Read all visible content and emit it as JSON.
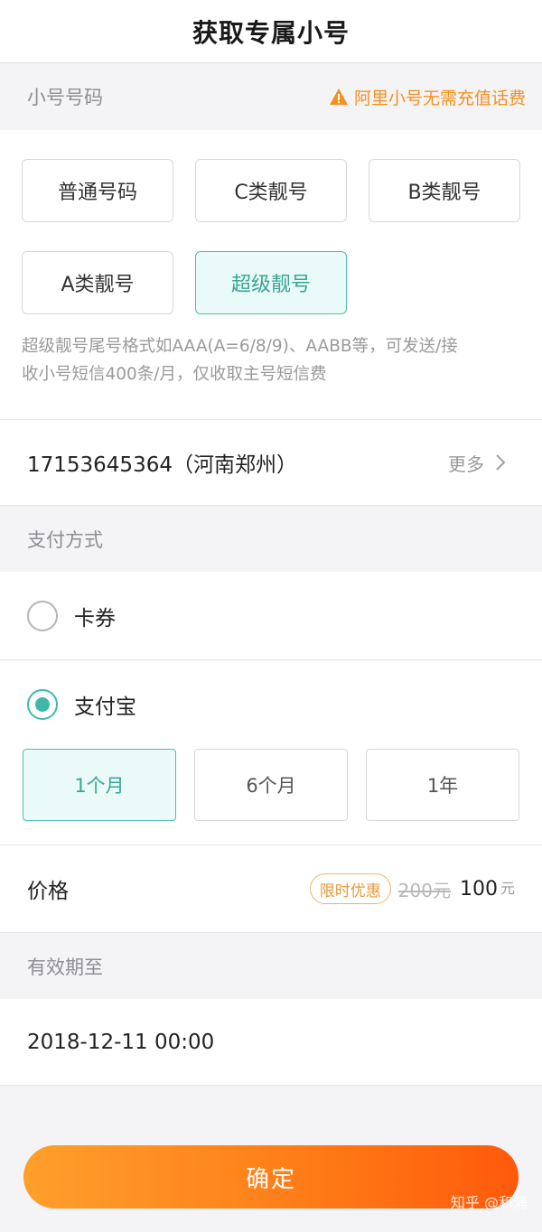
{
  "header": {
    "title": "获取专属小号"
  },
  "number_section": {
    "label": "小号号码",
    "notice": "阿里小号无需充值话费",
    "notice_icon": "warning-icon",
    "types": [
      {
        "label": "普通号码",
        "selected": false
      },
      {
        "label": "C类靓号",
        "selected": false
      },
      {
        "label": "B类靓号",
        "selected": false
      },
      {
        "label": "A类靓号",
        "selected": false
      },
      {
        "label": "超级靓号",
        "selected": true
      }
    ],
    "description_line1": "超级靓号尾号格式如AAA(A=6/8/9)、AABB等，可发送/接",
    "description_line2": "收小号短信400条/月，仅收取主号短信费"
  },
  "selected_number": {
    "number": "17153645364（河南郑州）",
    "more": "更多"
  },
  "payment": {
    "label": "支付方式",
    "options": [
      {
        "label": "卡券",
        "selected": false
      },
      {
        "label": "支付宝",
        "selected": true
      }
    ],
    "periods": [
      {
        "label": "1个月",
        "selected": true
      },
      {
        "label": "6个月",
        "selected": false
      },
      {
        "label": "1年",
        "selected": false
      }
    ]
  },
  "price": {
    "label": "价格",
    "promo": "限时优惠",
    "original": "200元",
    "current": "100",
    "currency": "元"
  },
  "validity": {
    "label": "有效期至",
    "date": "2018-12-11 00:00"
  },
  "confirm_label": "确定",
  "watermark": "知乎 @和浦",
  "colors": {
    "accent": "#3fb9a6",
    "orange": "#ff7d18",
    "warning": "#f5901e"
  }
}
